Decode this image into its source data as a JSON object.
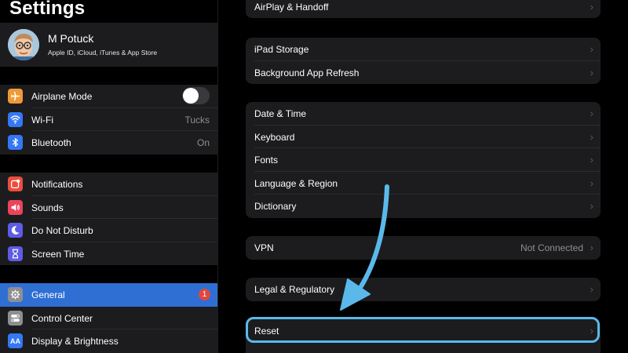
{
  "sidebar": {
    "title": "Settings",
    "profile": {
      "name": "M Potuck",
      "subtitle": "Apple ID, iCloud, iTunes & App Store"
    },
    "groups": [
      [
        {
          "label": "Airplane Mode",
          "icon": "airplane-icon",
          "color": "#f09a37",
          "toggle": "off"
        },
        {
          "label": "Wi-Fi",
          "icon": "wifi-icon",
          "color": "#3478f6",
          "value": "Tucks"
        },
        {
          "label": "Bluetooth",
          "icon": "bluetooth-icon",
          "color": "#3478f6",
          "value": "On"
        }
      ],
      [
        {
          "label": "Notifications",
          "icon": "notifications-icon",
          "color": "#eb4d3d"
        },
        {
          "label": "Sounds",
          "icon": "speaker-icon",
          "color": "#eb445a"
        },
        {
          "label": "Do Not Disturb",
          "icon": "moon-icon",
          "color": "#5e5ce6"
        },
        {
          "label": "Screen Time",
          "icon": "hourglass-icon",
          "color": "#5e5ce6"
        }
      ],
      [
        {
          "label": "General",
          "icon": "gear-icon",
          "color": "#8e8e93",
          "badge": "1",
          "selected": true
        },
        {
          "label": "Control Center",
          "icon": "toggles-icon",
          "color": "#8e8e93"
        },
        {
          "label": "Display & Brightness",
          "icon": "display-icon",
          "color": "#3478f6",
          "icon_text": "AA"
        }
      ]
    ]
  },
  "detail": {
    "groups": [
      [
        {
          "label": "AirPlay & Handoff"
        }
      ],
      [
        {
          "label": "iPad Storage"
        },
        {
          "label": "Background App Refresh"
        }
      ],
      [
        {
          "label": "Date & Time"
        },
        {
          "label": "Keyboard"
        },
        {
          "label": "Fonts"
        },
        {
          "label": "Language & Region"
        },
        {
          "label": "Dictionary"
        }
      ],
      [
        {
          "label": "VPN",
          "value": "Not Connected"
        }
      ],
      [
        {
          "label": "Legal & Regulatory"
        }
      ],
      [
        {
          "label": "Reset"
        }
      ]
    ],
    "chevron": "›",
    "highlight_color": "#5ab9ea"
  }
}
